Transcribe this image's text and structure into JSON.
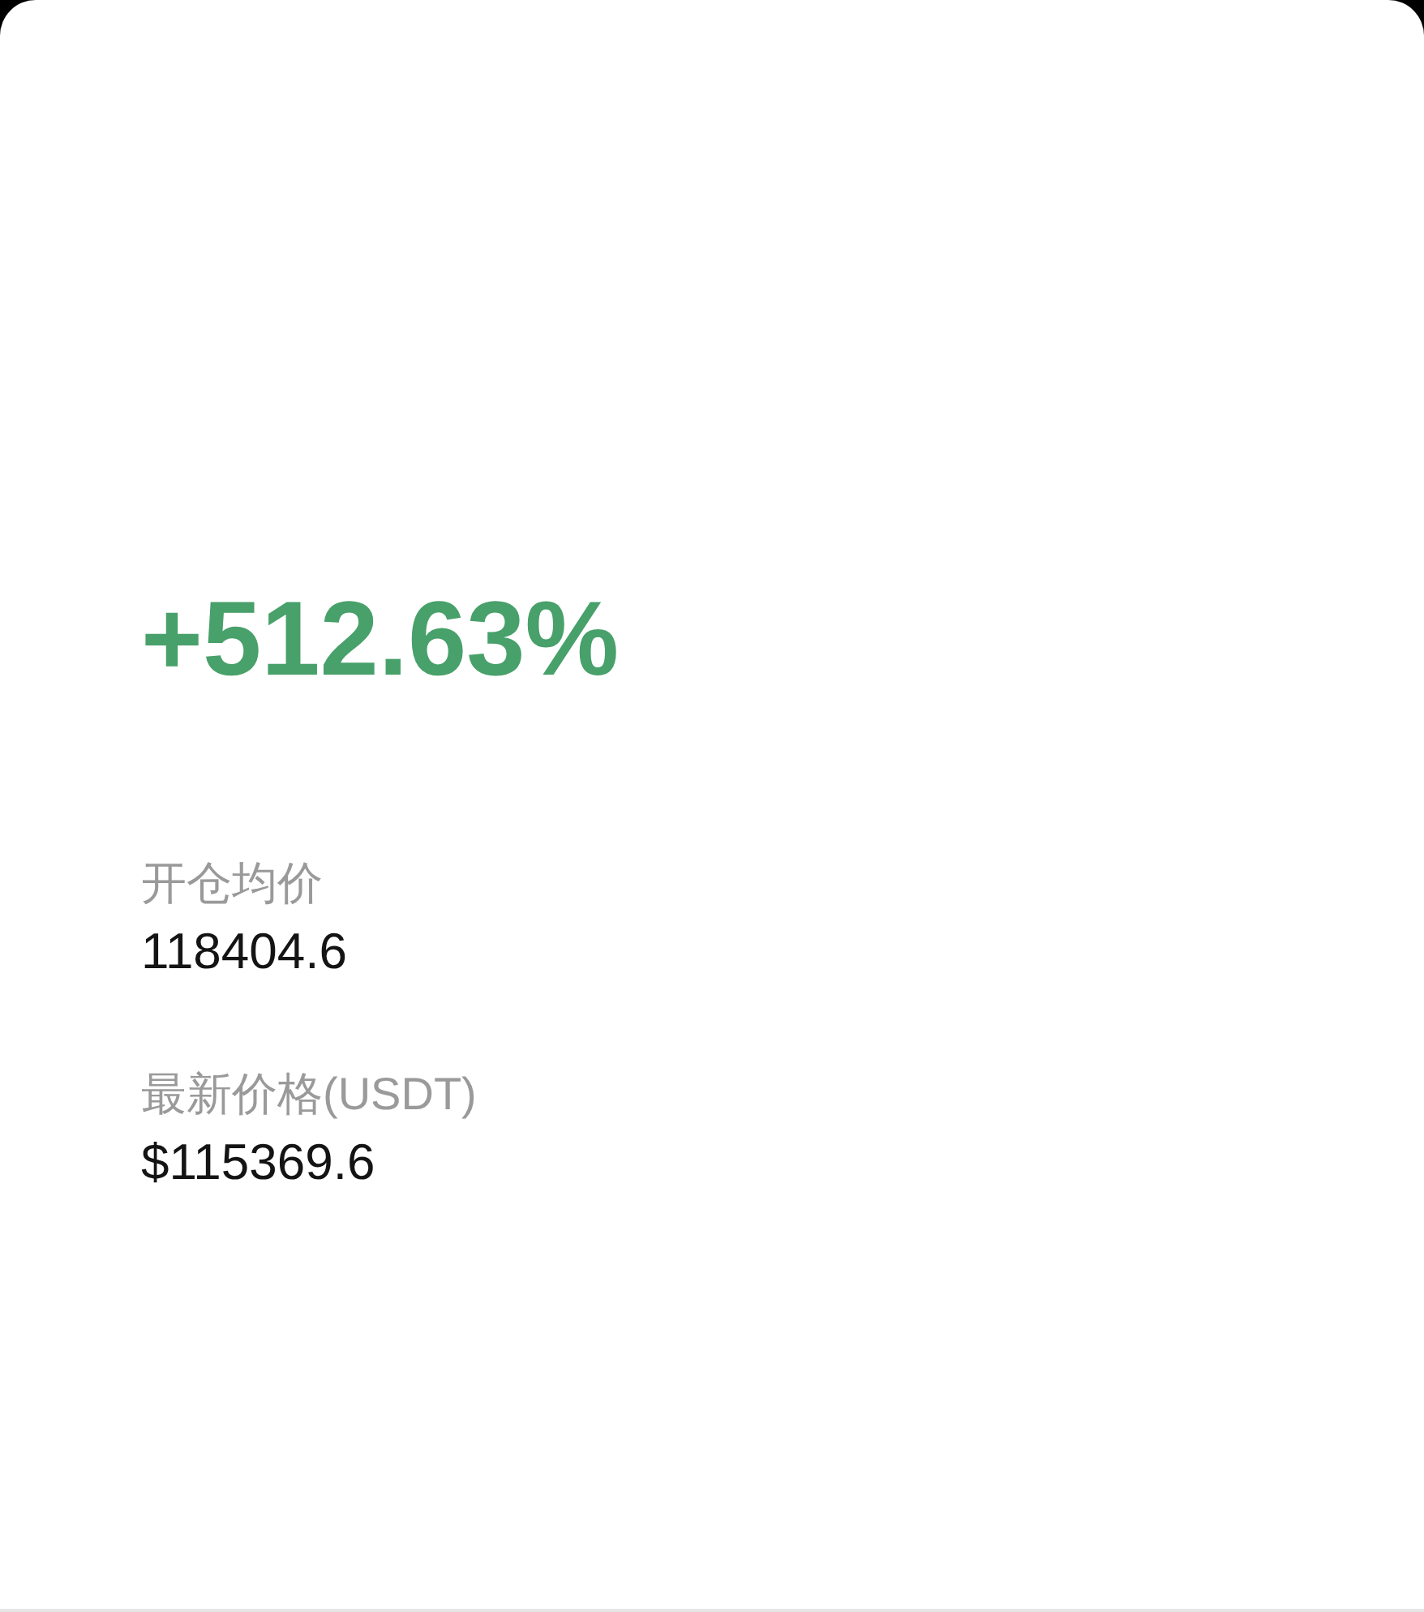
{
  "change": {
    "percent": "+512.63%"
  },
  "fields": [
    {
      "label": "开仓均价",
      "value": "118404.6"
    },
    {
      "label": "最新价格(USDT)",
      "value": "$115369.6"
    }
  ]
}
